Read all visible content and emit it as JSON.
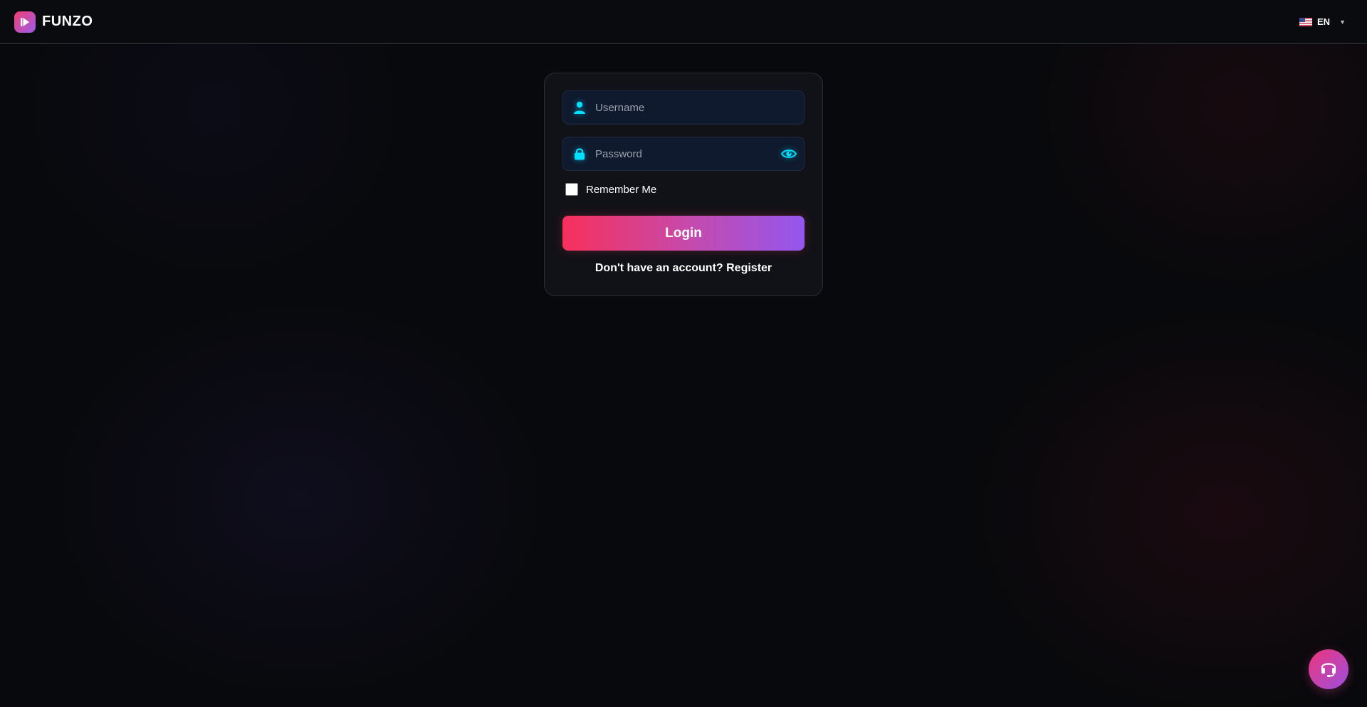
{
  "header": {
    "brand_name": "FUNZO",
    "language": {
      "code": "EN",
      "flag": "us-flag-icon"
    }
  },
  "login_form": {
    "username_placeholder": "Username",
    "username_value": "",
    "password_placeholder": "Password",
    "password_value": "",
    "remember_label": "Remember Me",
    "remember_checked": false,
    "login_label": "Login",
    "register_prompt": "Don't have an account?",
    "register_link": "Register"
  },
  "support_button": {
    "icon": "headset-icon"
  },
  "colors": {
    "accent_cyan": "#00e0ff",
    "gradient_start": "#f7305c",
    "gradient_end": "#9457ee",
    "background": "#08090c"
  }
}
